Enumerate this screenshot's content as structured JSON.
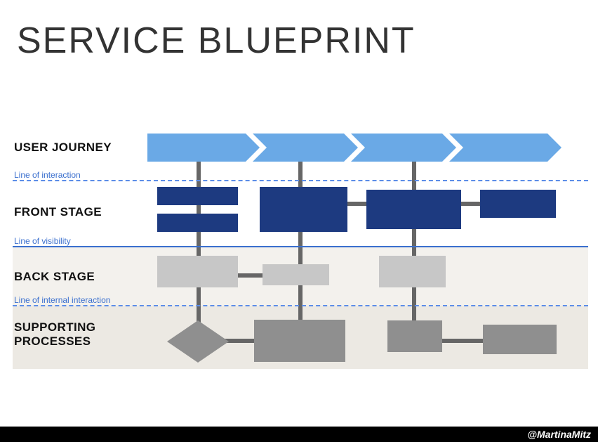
{
  "title": "SERVICE BLUEPRINT",
  "rows": {
    "user_journey": "USER JOURNEY",
    "front_stage": "FRONT STAGE",
    "back_stage": "BACK STAGE",
    "supporting_processes_line1": "SUPPORTING",
    "supporting_processes_line2": "PROCESSES"
  },
  "lines": {
    "interaction": "Line of interaction",
    "visibility": "Line of visibility",
    "internal": "Line of internal interaction"
  },
  "colors": {
    "arrow": "#6aa9e6",
    "front_box": "#1d3a80",
    "back_box": "#c7c7c7",
    "support_box": "#8f8f8f",
    "connector": "#666",
    "back_bg": "#f3f1ed",
    "support_bg": "#ece9e3"
  },
  "footer": "@MartinaMitz"
}
